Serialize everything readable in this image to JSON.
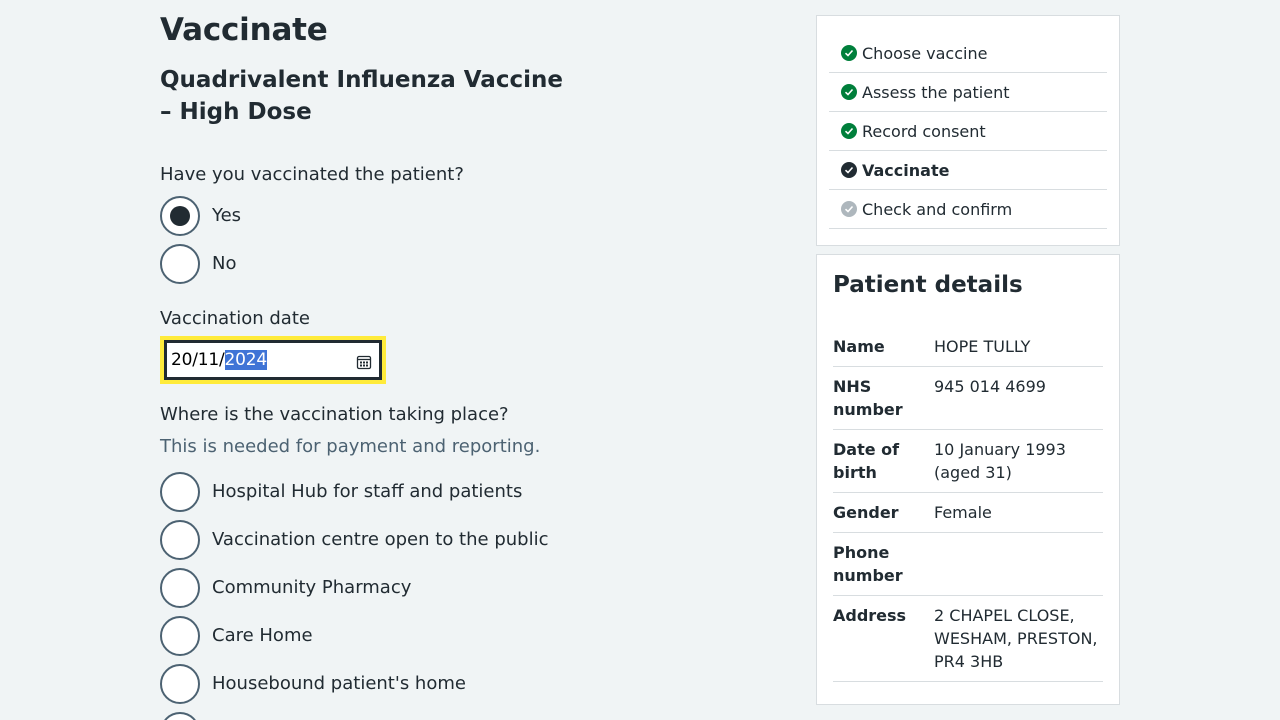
{
  "page": {
    "title": "Vaccinate",
    "vaccine": "Quadrivalent Influenza Vaccine – High Dose"
  },
  "vaccinated": {
    "question": "Have you vaccinated the patient?",
    "options": [
      {
        "label": "Yes",
        "checked": true
      },
      {
        "label": "No",
        "checked": false
      }
    ]
  },
  "date": {
    "label": "Vaccination date",
    "value_prefix": "20/11/",
    "value_selected": "2024"
  },
  "location": {
    "question": "Where is the vaccination taking place?",
    "hint": "This is needed for payment and reporting.",
    "options": [
      {
        "label": "Hospital Hub for staff and patients"
      },
      {
        "label": "Vaccination centre open to the public"
      },
      {
        "label": "Community Pharmacy"
      },
      {
        "label": "Care Home"
      },
      {
        "label": "Housebound patient's home"
      }
    ]
  },
  "tasks": [
    {
      "label": "Choose vaccine",
      "status": "done",
      "color": "#007f3b"
    },
    {
      "label": "Assess the patient",
      "status": "done",
      "color": "#007f3b"
    },
    {
      "label": "Record consent",
      "status": "done",
      "color": "#007f3b"
    },
    {
      "label": "Vaccinate",
      "status": "current",
      "color": "#212b32"
    },
    {
      "label": "Check and confirm",
      "status": "todo",
      "color": "#aeb7bd"
    }
  ],
  "patient": {
    "title": "Patient details",
    "rows": [
      {
        "key": "Name",
        "value": "HOPE TULLY"
      },
      {
        "key": "NHS number",
        "value": "945 014 4699"
      },
      {
        "key": "Date of birth",
        "value": "10 January 1993 (aged 31)"
      },
      {
        "key": "Gender",
        "value": "Female"
      },
      {
        "key": "Phone number",
        "value": ""
      },
      {
        "key": "Address",
        "value": "2 CHAPEL CLOSE, WESHAM, PRESTON, PR4 3HB"
      }
    ]
  }
}
